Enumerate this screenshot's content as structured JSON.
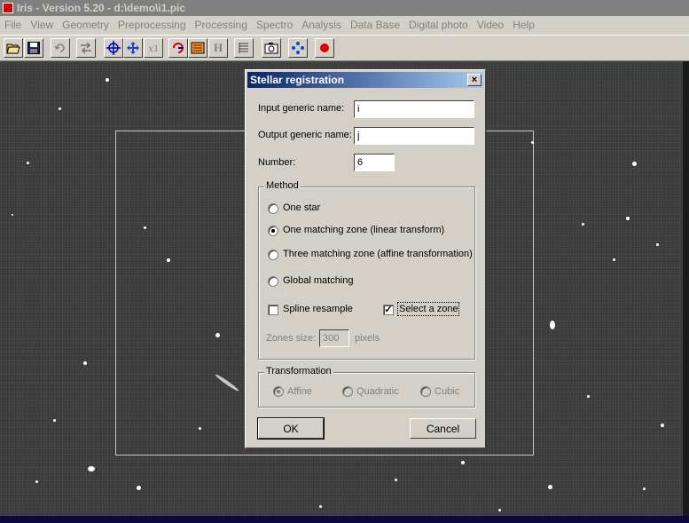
{
  "window": {
    "title": "Iris - Version 5.20 - d:\\demo\\i1.pic"
  },
  "menubar": {
    "items": [
      {
        "label": "File"
      },
      {
        "label": "View"
      },
      {
        "label": "Geometry"
      },
      {
        "label": "Preprocessing"
      },
      {
        "label": "Processing"
      },
      {
        "label": "Spectro"
      },
      {
        "label": "Analysis"
      },
      {
        "label": "Data Base"
      },
      {
        "label": "Digital photo"
      },
      {
        "label": "Video"
      },
      {
        "label": "Help"
      }
    ]
  },
  "toolbar": {
    "buttons": [
      {
        "icon": "open-folder-icon"
      },
      {
        "icon": "save-disk-icon"
      },
      {
        "icon": "undo-icon"
      },
      {
        "icon": "swap-icon"
      },
      {
        "icon": "crosshair-icon"
      },
      {
        "icon": "move-icon"
      },
      {
        "icon": "zoom-x1-icon",
        "text": "x1"
      },
      {
        "icon": "red-swirl-icon"
      },
      {
        "icon": "threshold-icon"
      },
      {
        "icon": "histogram-icon",
        "text": "H"
      },
      {
        "icon": "list-icon"
      },
      {
        "icon": "camera-icon"
      },
      {
        "icon": "blue-dots-icon"
      },
      {
        "icon": "record-dot-icon"
      }
    ]
  },
  "dialog": {
    "title": "Stellar registration",
    "close_label": "×",
    "input_label": "Input generic name:",
    "input_value": "i",
    "output_label": "Output generic name:",
    "output_value": "j",
    "number_label": "Number:",
    "number_value": "6",
    "method": {
      "legend": "Method",
      "options": [
        {
          "label": "One star",
          "checked": false
        },
        {
          "label": "One matching zone (linear transform)",
          "checked": true
        },
        {
          "label": "Three matching zone (affine transformation)",
          "checked": false
        },
        {
          "label": "Global matching",
          "checked": false
        }
      ],
      "spline_label": "Spline resample",
      "spline_checked": false,
      "select_zone_label": "Select a zone",
      "select_zone_checked": true,
      "zones_size_label": "Zones size:",
      "zones_size_value": "300",
      "zones_size_unit": "pixels"
    },
    "transformation": {
      "legend": "Transformation",
      "options": [
        {
          "label": "Affine",
          "checked": true
        },
        {
          "label": "Quadratic",
          "checked": false
        },
        {
          "label": "Cubic",
          "checked": false
        }
      ]
    },
    "ok_label": "OK",
    "cancel_label": "Cancel"
  }
}
